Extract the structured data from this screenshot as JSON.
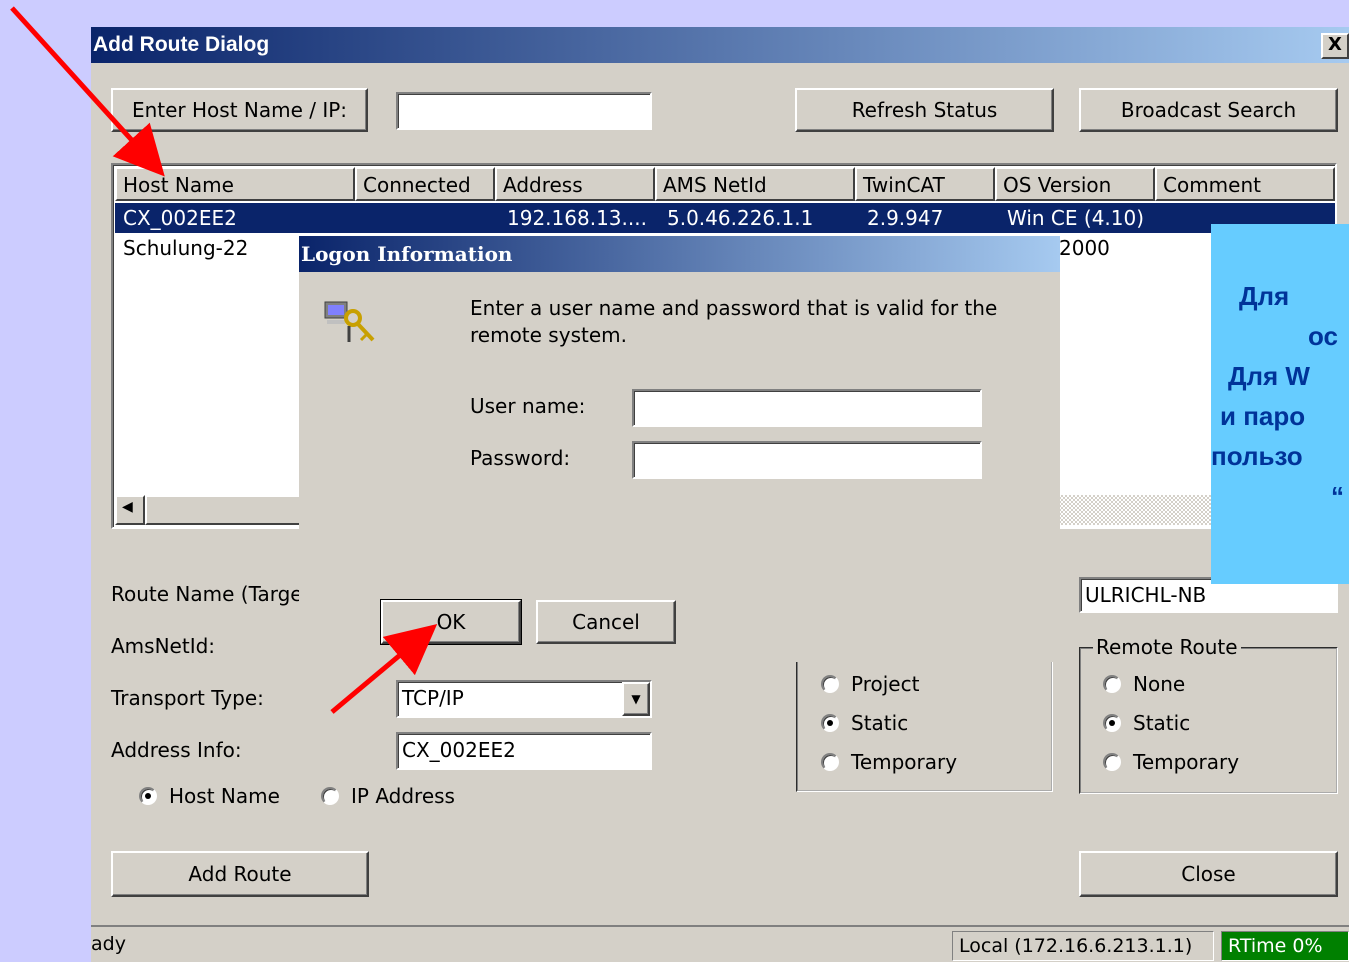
{
  "dialog": {
    "title": "Add Route Dialog",
    "close_glyph": "X",
    "enter_host_button": "Enter Host Name / IP:",
    "host_input_value": "",
    "refresh_button": "Refresh Status",
    "broadcast_button": "Broadcast Search",
    "columns": [
      "Host Name",
      "Connected",
      "Address",
      "AMS NetId",
      "TwinCAT",
      "OS Version",
      "Comment"
    ],
    "rows": [
      {
        "host": "CX_002EE2",
        "connected": "",
        "address": "192.168.13....",
        "ams": "5.0.46.226.1.1",
        "twincat": "2.9.947",
        "os": "Win CE (4.10)",
        "comment": ""
      },
      {
        "host": "Schulung-22",
        "connected": "",
        "address": "",
        "ams": "",
        "twincat": "",
        "os": "2000",
        "comment": ""
      }
    ],
    "scroll_left_glyph": "◀",
    "route_name_label": "Route Name (Targe",
    "route_name_right_value": "ULRICHL-NB",
    "amsnetid_label": "AmsNetId:",
    "transport_label": "Transport Type:",
    "transport_value": "TCP/IP",
    "address_info_label": "Address Info:",
    "address_info_value": "CX_002EE2",
    "radio_host_name": "Host Name",
    "radio_ip_address": "IP Address",
    "target_route_options": [
      "Project",
      "Static",
      "Temporary"
    ],
    "remote_route_title": "Remote Route",
    "remote_route_options": [
      "None",
      "Static",
      "Temporary"
    ],
    "add_route_button": "Add Route",
    "close_button": "Close",
    "status_text": "ady",
    "status_local": "Local (172.16.6.213.1.1)",
    "status_rtime": "RTime 0%"
  },
  "logon": {
    "title": "Logon Information",
    "message_line1": "Enter a user name and password that is valid for the",
    "message_line2": "remote system.",
    "user_label": "User name:",
    "user_value": "",
    "password_label": "Password:",
    "password_value": "",
    "ok_button": "OK",
    "cancel_button": "Cancel"
  },
  "callout": {
    "lines": [
      "Для",
      "ос",
      "Для W",
      "и паро",
      "пользо",
      "“"
    ]
  },
  "colors": {
    "background": "#ccccff",
    "dialog_face": "#d4d0c8",
    "title_start": "#0a246a",
    "title_end": "#a6caf0",
    "callout_bg": "#66ccff",
    "callout_text": "#003399",
    "arrow": "#ff0000",
    "rtime_bg": "#008000"
  }
}
